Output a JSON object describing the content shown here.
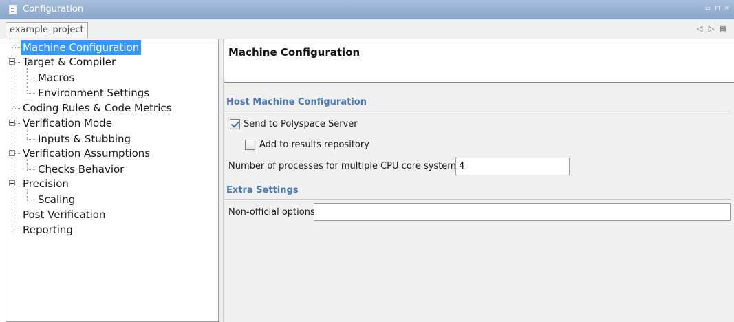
{
  "window": {
    "title": "Configuration",
    "controls": [
      "⧉",
      "⊓",
      "✕"
    ]
  },
  "tabs": {
    "active": "example_project",
    "nav_prev": "◁",
    "nav_next": "▷",
    "nav_menu": "▤"
  },
  "tree": {
    "items": [
      {
        "label": "Machine Configuration",
        "selected": true
      },
      {
        "label": "Target & Compiler",
        "expandable": true
      },
      {
        "label": "Macros"
      },
      {
        "label": "Environment Settings"
      },
      {
        "label": "Coding Rules & Code Metrics"
      },
      {
        "label": "Verification Mode",
        "expandable": true
      },
      {
        "label": "Inputs & Stubbing"
      },
      {
        "label": "Verification Assumptions",
        "expandable": true
      },
      {
        "label": "Checks Behavior"
      },
      {
        "label": "Precision",
        "expandable": true
      },
      {
        "label": "Scaling"
      },
      {
        "label": "Post Verification"
      },
      {
        "label": "Reporting"
      }
    ]
  },
  "panel": {
    "title": "Machine Configuration",
    "host_section": {
      "title": "Host Machine Configuration",
      "send_to_server": {
        "label": "Send to Polyspace Server",
        "checked": true
      },
      "add_to_repo": {
        "label": "Add to results repository",
        "checked": false
      },
      "processes": {
        "label": "Number of processes for multiple CPU core systems",
        "value": "4"
      }
    },
    "extra_section": {
      "title": "Extra Settings",
      "non_official": {
        "label": "Non-official options",
        "value": ""
      }
    }
  },
  "colors": {
    "titlebar": "#8aa6cb",
    "selection": "#3399ff",
    "section_title": "#4a7ab8"
  }
}
